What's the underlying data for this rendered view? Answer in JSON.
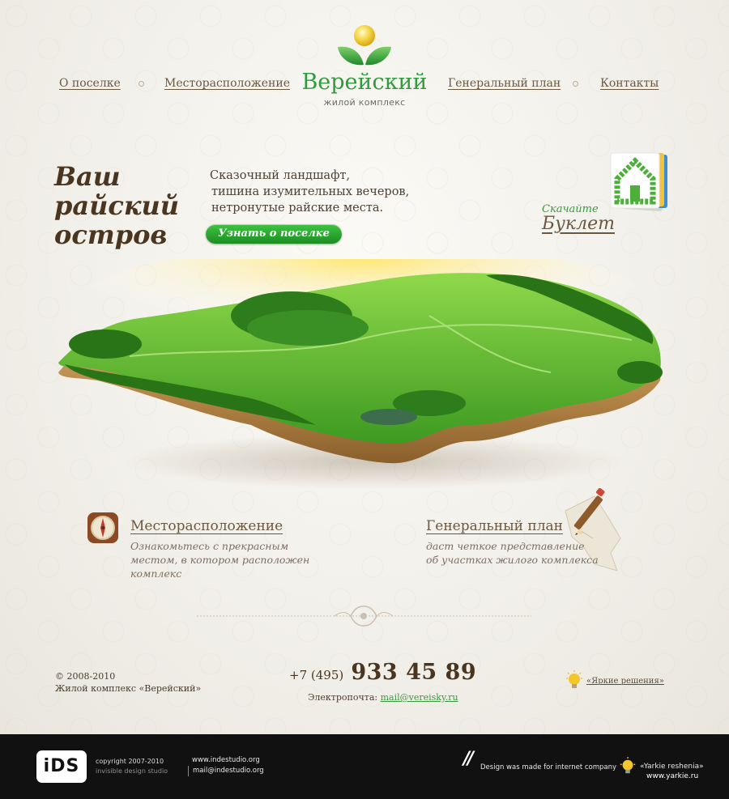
{
  "nav": {
    "about": "О поселке",
    "location": "Месторасположение",
    "plan": "Генеральный план",
    "contacts": "Контакты"
  },
  "logo": {
    "title": "Верейский",
    "subtitle": "жилой комплекс"
  },
  "hero": {
    "title_line1": "Ваш",
    "title_line2": "райский",
    "title_line3": "остров",
    "text_line1": "Сказочный ландшафт,",
    "text_line2": "тишина изумительных вечеров,",
    "text_line3": "нетронутые райские места.",
    "button": "Узнать о поселке"
  },
  "booklet": {
    "small": "Скачайте",
    "big": "Буклет"
  },
  "features": {
    "location_title": "Месторасположение",
    "location_desc_1": "Ознакомьтесь с прекрасным",
    "location_desc_2": "местом, в котором расположен",
    "location_desc_3": "комплекс",
    "plan_title": "Генеральный план",
    "plan_desc_1": "даст четкое представление",
    "plan_desc_2": "об участках жилого комплекса"
  },
  "footer": {
    "copyright_1": "© 2008-2010",
    "copyright_2": "Жилой комплекс «Верейский»",
    "phone_code": "+7 (495)",
    "phone_number": "933 45 89",
    "email_label": "Электропочта:",
    "email": "mail@vereisky.ru",
    "brand": "«Яркие решения»"
  },
  "footer_dark": {
    "logo": "iDS",
    "copyright": "copyright 2007-2010",
    "studio": "invisible design studio",
    "site": "www.indestudio.org",
    "mail": "mail@indestudio.org",
    "slashes": "//",
    "made_for": "Design was made for internet company",
    "brand": "«Yarkie reshenia»",
    "brand_url": "www.yarkie.ru"
  },
  "colors": {
    "accent_green": "#2f9b3e",
    "text_brown": "#4a3620",
    "footer_bg": "#111111"
  }
}
